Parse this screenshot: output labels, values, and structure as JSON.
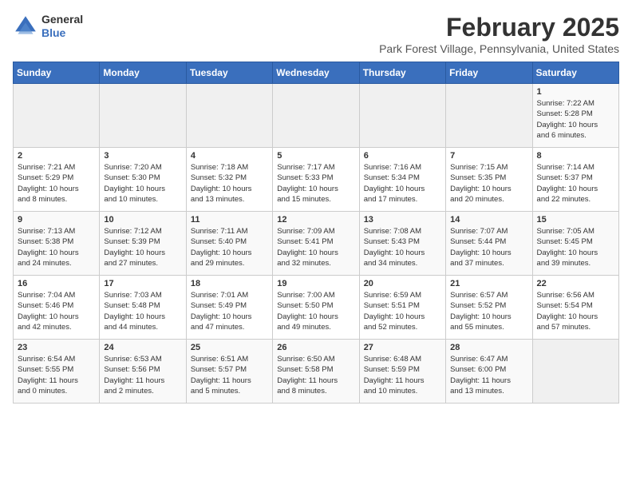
{
  "logo": {
    "general": "General",
    "blue": "Blue"
  },
  "header": {
    "month_year": "February 2025",
    "location": "Park Forest Village, Pennsylvania, United States"
  },
  "weekdays": [
    "Sunday",
    "Monday",
    "Tuesday",
    "Wednesday",
    "Thursday",
    "Friday",
    "Saturday"
  ],
  "weeks": [
    [
      {
        "day": "",
        "info": ""
      },
      {
        "day": "",
        "info": ""
      },
      {
        "day": "",
        "info": ""
      },
      {
        "day": "",
        "info": ""
      },
      {
        "day": "",
        "info": ""
      },
      {
        "day": "",
        "info": ""
      },
      {
        "day": "1",
        "info": "Sunrise: 7:22 AM\nSunset: 5:28 PM\nDaylight: 10 hours\nand 6 minutes."
      }
    ],
    [
      {
        "day": "2",
        "info": "Sunrise: 7:21 AM\nSunset: 5:29 PM\nDaylight: 10 hours\nand 8 minutes."
      },
      {
        "day": "3",
        "info": "Sunrise: 7:20 AM\nSunset: 5:30 PM\nDaylight: 10 hours\nand 10 minutes."
      },
      {
        "day": "4",
        "info": "Sunrise: 7:18 AM\nSunset: 5:32 PM\nDaylight: 10 hours\nand 13 minutes."
      },
      {
        "day": "5",
        "info": "Sunrise: 7:17 AM\nSunset: 5:33 PM\nDaylight: 10 hours\nand 15 minutes."
      },
      {
        "day": "6",
        "info": "Sunrise: 7:16 AM\nSunset: 5:34 PM\nDaylight: 10 hours\nand 17 minutes."
      },
      {
        "day": "7",
        "info": "Sunrise: 7:15 AM\nSunset: 5:35 PM\nDaylight: 10 hours\nand 20 minutes."
      },
      {
        "day": "8",
        "info": "Sunrise: 7:14 AM\nSunset: 5:37 PM\nDaylight: 10 hours\nand 22 minutes."
      }
    ],
    [
      {
        "day": "9",
        "info": "Sunrise: 7:13 AM\nSunset: 5:38 PM\nDaylight: 10 hours\nand 24 minutes."
      },
      {
        "day": "10",
        "info": "Sunrise: 7:12 AM\nSunset: 5:39 PM\nDaylight: 10 hours\nand 27 minutes."
      },
      {
        "day": "11",
        "info": "Sunrise: 7:11 AM\nSunset: 5:40 PM\nDaylight: 10 hours\nand 29 minutes."
      },
      {
        "day": "12",
        "info": "Sunrise: 7:09 AM\nSunset: 5:41 PM\nDaylight: 10 hours\nand 32 minutes."
      },
      {
        "day": "13",
        "info": "Sunrise: 7:08 AM\nSunset: 5:43 PM\nDaylight: 10 hours\nand 34 minutes."
      },
      {
        "day": "14",
        "info": "Sunrise: 7:07 AM\nSunset: 5:44 PM\nDaylight: 10 hours\nand 37 minutes."
      },
      {
        "day": "15",
        "info": "Sunrise: 7:05 AM\nSunset: 5:45 PM\nDaylight: 10 hours\nand 39 minutes."
      }
    ],
    [
      {
        "day": "16",
        "info": "Sunrise: 7:04 AM\nSunset: 5:46 PM\nDaylight: 10 hours\nand 42 minutes."
      },
      {
        "day": "17",
        "info": "Sunrise: 7:03 AM\nSunset: 5:48 PM\nDaylight: 10 hours\nand 44 minutes."
      },
      {
        "day": "18",
        "info": "Sunrise: 7:01 AM\nSunset: 5:49 PM\nDaylight: 10 hours\nand 47 minutes."
      },
      {
        "day": "19",
        "info": "Sunrise: 7:00 AM\nSunset: 5:50 PM\nDaylight: 10 hours\nand 49 minutes."
      },
      {
        "day": "20",
        "info": "Sunrise: 6:59 AM\nSunset: 5:51 PM\nDaylight: 10 hours\nand 52 minutes."
      },
      {
        "day": "21",
        "info": "Sunrise: 6:57 AM\nSunset: 5:52 PM\nDaylight: 10 hours\nand 55 minutes."
      },
      {
        "day": "22",
        "info": "Sunrise: 6:56 AM\nSunset: 5:54 PM\nDaylight: 10 hours\nand 57 minutes."
      }
    ],
    [
      {
        "day": "23",
        "info": "Sunrise: 6:54 AM\nSunset: 5:55 PM\nDaylight: 11 hours\nand 0 minutes."
      },
      {
        "day": "24",
        "info": "Sunrise: 6:53 AM\nSunset: 5:56 PM\nDaylight: 11 hours\nand 2 minutes."
      },
      {
        "day": "25",
        "info": "Sunrise: 6:51 AM\nSunset: 5:57 PM\nDaylight: 11 hours\nand 5 minutes."
      },
      {
        "day": "26",
        "info": "Sunrise: 6:50 AM\nSunset: 5:58 PM\nDaylight: 11 hours\nand 8 minutes."
      },
      {
        "day": "27",
        "info": "Sunrise: 6:48 AM\nSunset: 5:59 PM\nDaylight: 11 hours\nand 10 minutes."
      },
      {
        "day": "28",
        "info": "Sunrise: 6:47 AM\nSunset: 6:00 PM\nDaylight: 11 hours\nand 13 minutes."
      },
      {
        "day": "",
        "info": ""
      }
    ]
  ]
}
